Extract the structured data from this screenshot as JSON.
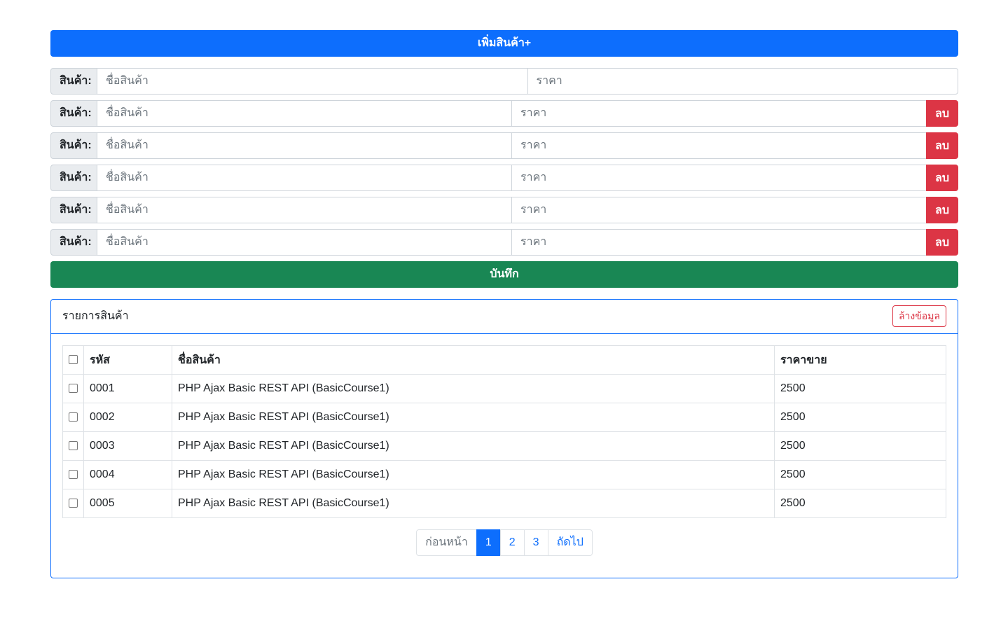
{
  "add_button": {
    "label": "เพิ่มสินค้า+"
  },
  "product_rows": [
    {
      "label": "สินค้า:",
      "name_placeholder": "ชื่อสินค้า",
      "price_placeholder": "ราคา",
      "delete_label": ""
    },
    {
      "label": "สินค้า:",
      "name_placeholder": "ชื่อสินค้า",
      "price_placeholder": "ราคา",
      "delete_label": "ลบ"
    },
    {
      "label": "สินค้า:",
      "name_placeholder": "ชื่อสินค้า",
      "price_placeholder": "ราคา",
      "delete_label": "ลบ"
    },
    {
      "label": "สินค้า:",
      "name_placeholder": "ชื่อสินค้า",
      "price_placeholder": "ราคา",
      "delete_label": "ลบ"
    },
    {
      "label": "สินค้า:",
      "name_placeholder": "ชื่อสินค้า",
      "price_placeholder": "ราคา",
      "delete_label": "ลบ"
    },
    {
      "label": "สินค้า:",
      "name_placeholder": "ชื่อสินค้า",
      "price_placeholder": "ราคา",
      "delete_label": "ลบ"
    }
  ],
  "save_button": {
    "label": "บันทึก"
  },
  "list_card": {
    "title": "รายการสินค้า",
    "clear_label": "ล้างข้อมูล",
    "columns": [
      "รหัส",
      "ชื่อสินค้า",
      "ราคาขาย"
    ],
    "rows": [
      {
        "code": "0001",
        "name": "PHP Ajax Basic REST API (BasicCourse1)",
        "price": "2500"
      },
      {
        "code": "0002",
        "name": "PHP Ajax Basic REST API (BasicCourse1)",
        "price": "2500"
      },
      {
        "code": "0003",
        "name": "PHP Ajax Basic REST API (BasicCourse1)",
        "price": "2500"
      },
      {
        "code": "0004",
        "name": "PHP Ajax Basic REST API (BasicCourse1)",
        "price": "2500"
      },
      {
        "code": "0005",
        "name": "PHP Ajax Basic REST API (BasicCourse1)",
        "price": "2500"
      }
    ]
  },
  "pagination": {
    "prev_label": "ก่อนหน้า",
    "pages": [
      "1",
      "2",
      "3"
    ],
    "active_page": "1",
    "next_label": "ถัดไป"
  },
  "colors": {
    "primary": "#0d6efd",
    "success": "#198754",
    "danger": "#dc3545"
  }
}
